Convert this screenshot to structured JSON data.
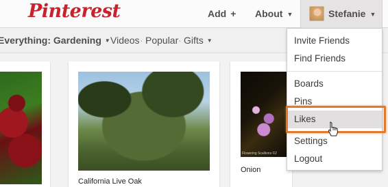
{
  "header": {
    "logo": "Pinterest",
    "add_label": "Add",
    "add_icon": "+",
    "about_label": "About",
    "user_name": "Stefanie"
  },
  "subnav": {
    "category_label": "Everything: Gardening",
    "videos_label": "Videos",
    "popular_label": "Popular",
    "gifts_label": "Gifts"
  },
  "pins": {
    "oak_caption": "California Live Oak",
    "onion_caption": "Onion",
    "onion_photo_note": "Flowering Scallions ©2"
  },
  "dropdown": {
    "items": [
      "Invite Friends",
      "Find Friends",
      "Boards",
      "Pins",
      "Likes",
      "Settings",
      "Logout"
    ],
    "highlighted": "Likes"
  },
  "colors": {
    "brand": "#c8232c",
    "highlight": "#e07b2d"
  }
}
